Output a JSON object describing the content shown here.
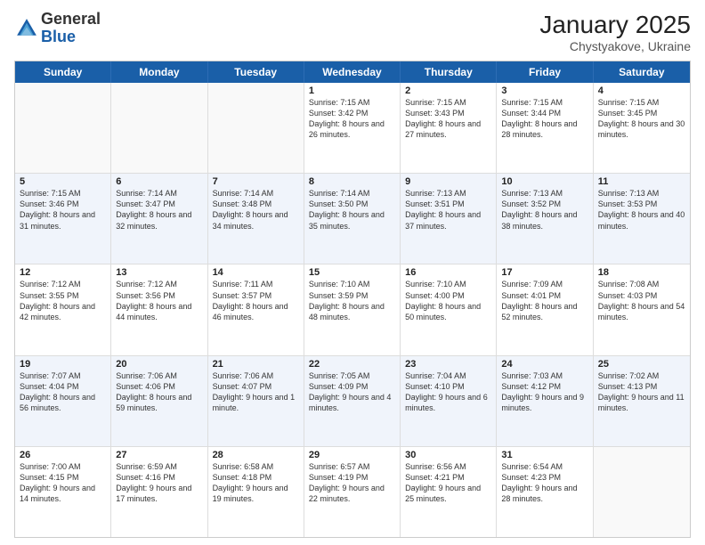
{
  "logo": {
    "general": "General",
    "blue": "Blue"
  },
  "title": "January 2025",
  "location": "Chystyakove, Ukraine",
  "days": [
    "Sunday",
    "Monday",
    "Tuesday",
    "Wednesday",
    "Thursday",
    "Friday",
    "Saturday"
  ],
  "rows": [
    [
      {
        "day": "",
        "text": ""
      },
      {
        "day": "",
        "text": ""
      },
      {
        "day": "",
        "text": ""
      },
      {
        "day": "1",
        "text": "Sunrise: 7:15 AM\nSunset: 3:42 PM\nDaylight: 8 hours and 26 minutes."
      },
      {
        "day": "2",
        "text": "Sunrise: 7:15 AM\nSunset: 3:43 PM\nDaylight: 8 hours and 27 minutes."
      },
      {
        "day": "3",
        "text": "Sunrise: 7:15 AM\nSunset: 3:44 PM\nDaylight: 8 hours and 28 minutes."
      },
      {
        "day": "4",
        "text": "Sunrise: 7:15 AM\nSunset: 3:45 PM\nDaylight: 8 hours and 30 minutes."
      }
    ],
    [
      {
        "day": "5",
        "text": "Sunrise: 7:15 AM\nSunset: 3:46 PM\nDaylight: 8 hours and 31 minutes."
      },
      {
        "day": "6",
        "text": "Sunrise: 7:14 AM\nSunset: 3:47 PM\nDaylight: 8 hours and 32 minutes."
      },
      {
        "day": "7",
        "text": "Sunrise: 7:14 AM\nSunset: 3:48 PM\nDaylight: 8 hours and 34 minutes."
      },
      {
        "day": "8",
        "text": "Sunrise: 7:14 AM\nSunset: 3:50 PM\nDaylight: 8 hours and 35 minutes."
      },
      {
        "day": "9",
        "text": "Sunrise: 7:13 AM\nSunset: 3:51 PM\nDaylight: 8 hours and 37 minutes."
      },
      {
        "day": "10",
        "text": "Sunrise: 7:13 AM\nSunset: 3:52 PM\nDaylight: 8 hours and 38 minutes."
      },
      {
        "day": "11",
        "text": "Sunrise: 7:13 AM\nSunset: 3:53 PM\nDaylight: 8 hours and 40 minutes."
      }
    ],
    [
      {
        "day": "12",
        "text": "Sunrise: 7:12 AM\nSunset: 3:55 PM\nDaylight: 8 hours and 42 minutes."
      },
      {
        "day": "13",
        "text": "Sunrise: 7:12 AM\nSunset: 3:56 PM\nDaylight: 8 hours and 44 minutes."
      },
      {
        "day": "14",
        "text": "Sunrise: 7:11 AM\nSunset: 3:57 PM\nDaylight: 8 hours and 46 minutes."
      },
      {
        "day": "15",
        "text": "Sunrise: 7:10 AM\nSunset: 3:59 PM\nDaylight: 8 hours and 48 minutes."
      },
      {
        "day": "16",
        "text": "Sunrise: 7:10 AM\nSunset: 4:00 PM\nDaylight: 8 hours and 50 minutes."
      },
      {
        "day": "17",
        "text": "Sunrise: 7:09 AM\nSunset: 4:01 PM\nDaylight: 8 hours and 52 minutes."
      },
      {
        "day": "18",
        "text": "Sunrise: 7:08 AM\nSunset: 4:03 PM\nDaylight: 8 hours and 54 minutes."
      }
    ],
    [
      {
        "day": "19",
        "text": "Sunrise: 7:07 AM\nSunset: 4:04 PM\nDaylight: 8 hours and 56 minutes."
      },
      {
        "day": "20",
        "text": "Sunrise: 7:06 AM\nSunset: 4:06 PM\nDaylight: 8 hours and 59 minutes."
      },
      {
        "day": "21",
        "text": "Sunrise: 7:06 AM\nSunset: 4:07 PM\nDaylight: 9 hours and 1 minute."
      },
      {
        "day": "22",
        "text": "Sunrise: 7:05 AM\nSunset: 4:09 PM\nDaylight: 9 hours and 4 minutes."
      },
      {
        "day": "23",
        "text": "Sunrise: 7:04 AM\nSunset: 4:10 PM\nDaylight: 9 hours and 6 minutes."
      },
      {
        "day": "24",
        "text": "Sunrise: 7:03 AM\nSunset: 4:12 PM\nDaylight: 9 hours and 9 minutes."
      },
      {
        "day": "25",
        "text": "Sunrise: 7:02 AM\nSunset: 4:13 PM\nDaylight: 9 hours and 11 minutes."
      }
    ],
    [
      {
        "day": "26",
        "text": "Sunrise: 7:00 AM\nSunset: 4:15 PM\nDaylight: 9 hours and 14 minutes."
      },
      {
        "day": "27",
        "text": "Sunrise: 6:59 AM\nSunset: 4:16 PM\nDaylight: 9 hours and 17 minutes."
      },
      {
        "day": "28",
        "text": "Sunrise: 6:58 AM\nSunset: 4:18 PM\nDaylight: 9 hours and 19 minutes."
      },
      {
        "day": "29",
        "text": "Sunrise: 6:57 AM\nSunset: 4:19 PM\nDaylight: 9 hours and 22 minutes."
      },
      {
        "day": "30",
        "text": "Sunrise: 6:56 AM\nSunset: 4:21 PM\nDaylight: 9 hours and 25 minutes."
      },
      {
        "day": "31",
        "text": "Sunrise: 6:54 AM\nSunset: 4:23 PM\nDaylight: 9 hours and 28 minutes."
      },
      {
        "day": "",
        "text": ""
      }
    ]
  ]
}
